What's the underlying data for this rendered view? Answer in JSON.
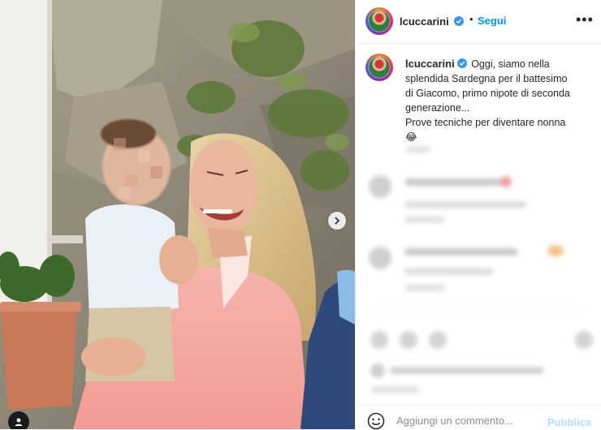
{
  "post": {
    "username": "lcuccarini",
    "verified": true,
    "follow_label": "Segui",
    "separator": "•",
    "more_label": "•••",
    "caption_lines": [
      "Oggi, siamo nella",
      "splendida Sardegna per il battesimo",
      "di Giacomo, primo nipote di seconda",
      "generazione...",
      "Prove tecniche per diventare nonna",
      "😂"
    ]
  },
  "comment_box": {
    "placeholder": "Aggiungi un commento...",
    "publish_label": "Pubblica"
  },
  "colors": {
    "accent": "#0095f6",
    "publish_disabled": "#b2dffc",
    "verified": "#3897f0",
    "text": "#262626"
  },
  "icons": [
    "verified-badge-icon",
    "more-options-icon",
    "emoji-icon",
    "chevron-right-icon",
    "user-tag-icon"
  ]
}
